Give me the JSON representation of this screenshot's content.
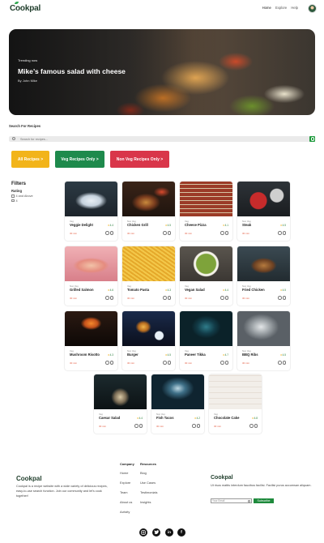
{
  "header": {
    "logo": "Cookpal",
    "nav": [
      "Home",
      "Explore",
      "Help"
    ]
  },
  "hero": {
    "tag": "Trending now",
    "title": "Mike’s famous salad with cheese",
    "author": "By John Mike"
  },
  "search": {
    "label": "Search For Recipes",
    "placeholder": "Search for recipes..."
  },
  "filter_buttons": [
    "All Recipes >",
    "Veg Recipes Only >",
    "Non Veg Recipes Only >"
  ],
  "filters": {
    "title": "Filters",
    "rating_label": "Rating",
    "options": [
      "4 and Above",
      "4"
    ]
  },
  "recipes": [
    {
      "category": "Veg",
      "name": "Veggie Delight",
      "rating": "4.4",
      "time": "30 min"
    },
    {
      "category": "Non Veg",
      "name": "Chicken Grill",
      "rating": "4.5",
      "time": "30 min"
    },
    {
      "category": "Veg",
      "name": "Cheese Pizza",
      "rating": "4.1",
      "time": "30 min"
    },
    {
      "category": "Non Veg",
      "name": "Steak",
      "rating": "4.5",
      "time": "30 min"
    },
    {
      "category": "Non Veg",
      "name": "Grilled Salmon",
      "rating": "4.6",
      "time": "30 min"
    },
    {
      "category": "Veg",
      "name": "Tomato Pasta",
      "rating": "4.3",
      "time": "30 min"
    },
    {
      "category": "Veg",
      "name": "Vegan Salad",
      "rating": "4.4",
      "time": "30 min"
    },
    {
      "category": "Non Veg",
      "name": "Fried Chicken",
      "rating": "4.5",
      "time": "30 min"
    },
    {
      "category": "Veg",
      "name": "Mushroom Risotto",
      "rating": "4.3",
      "time": "30 min"
    },
    {
      "category": "Non Veg",
      "name": "Burger",
      "rating": "4.5",
      "time": "30 min"
    },
    {
      "category": "Veg",
      "name": "Paneer Tikka",
      "rating": "4.7",
      "time": "30 min"
    },
    {
      "category": "Non Veg",
      "name": "BBQ Ribs",
      "rating": "4.5",
      "time": "30 min"
    },
    {
      "category": "Veg",
      "name": "Caesar Salad",
      "rating": "4.4",
      "time": "30 min"
    },
    {
      "category": "Non Veg",
      "name": "Fish Tacos",
      "rating": "4.2",
      "time": "30 min"
    },
    {
      "category": "Veg",
      "name": "Chocolate Cake",
      "rating": "4.8",
      "time": "30 min"
    }
  ],
  "footer": {
    "logo": "Cookpal",
    "description": "Cookpal is a recipe website with a wide variety of delicious recipes, easy-to-use search function. Join our community and let's cook together!",
    "company_heading": "Company",
    "company_links": [
      "Home",
      "Explore",
      "Team",
      "About us",
      "Activity"
    ],
    "resources_heading": "Resources",
    "resources_links": [
      "Blog",
      "Use Cases",
      "Testimonials",
      "Insights"
    ],
    "logo2": "Cookpal",
    "newsletter_text": "Ut risus mattis interdum faucibus facilisi. Facilisi purus accumsan aliquam.",
    "email_placeholder": "Your Email",
    "subscribe_label": "Subscribe",
    "social": [
      "instagram-icon",
      "twitter-icon",
      "linkedin-icon",
      "facebook-icon"
    ]
  },
  "colors": {
    "brand_green": "#1e8a4c",
    "yellow": "#f2b41a",
    "red": "#d9364a"
  }
}
